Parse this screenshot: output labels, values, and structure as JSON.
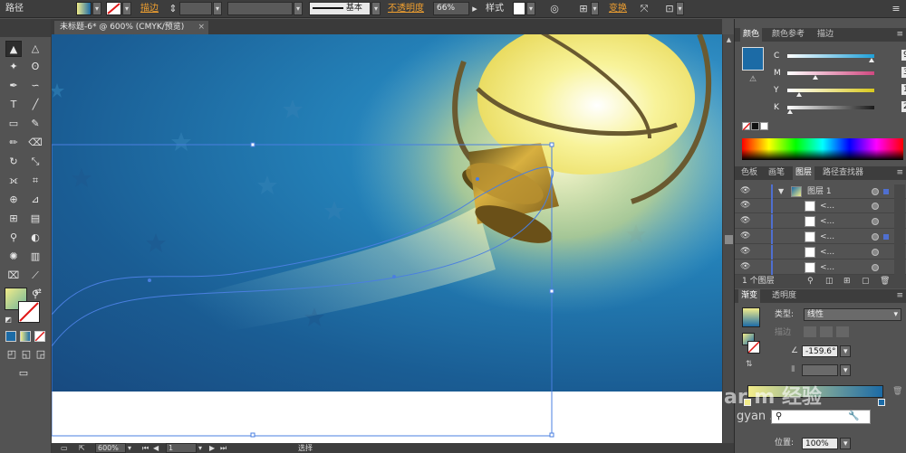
{
  "controlbar": {
    "object_label": "路径",
    "stroke_label": "描边",
    "stroke_profile": "基本",
    "opacity_label": "不透明度",
    "opacity_value": "66%",
    "style_label": "样式",
    "transform_label": "变换"
  },
  "document": {
    "tab_title": "未标题-6* @ 600% (CMYK/预览)",
    "close_glyph": "×"
  },
  "statusbar": {
    "zoom": "600%",
    "artboard_nav_value": "1",
    "tool_status": "选择"
  },
  "color_panel": {
    "tabs": [
      "颜色",
      "颜色参考",
      "描边"
    ],
    "channels": [
      {
        "name": "C",
        "value": "97.3",
        "level": 0.973,
        "color": "#1ea0d8"
      },
      {
        "name": "M",
        "value": "31.99",
        "level": 0.32,
        "color": "#d04880"
      },
      {
        "name": "Y",
        "value": "13.91",
        "level": 0.139,
        "color": "#d8c81e"
      },
      {
        "name": "K",
        "value": "2.87",
        "level": 0.029,
        "color": "#1a1a1a"
      }
    ],
    "fill_color": "#1c6ba6",
    "unit": "%"
  },
  "layers_panel": {
    "tabs": [
      "色板",
      "画笔",
      "图层",
      "路径查找器"
    ],
    "top_layer": "图层 1",
    "sublayers": [
      "<...",
      "<...",
      "<...",
      "<...",
      "<..."
    ],
    "footer_count": "1 个图层"
  },
  "gradient_panel": {
    "tabs": [
      "渐变",
      "透明度"
    ],
    "type_label": "类型:",
    "type_value": "线性",
    "stroke_label": "描边",
    "angle_label": "∠",
    "angle_value": "-159.6°",
    "location_label": "位置:",
    "location_value": "100%",
    "ramp_start_color": "#f2ec8a",
    "ramp_end_color": "#1c6ba6"
  },
  "watermark": {
    "line1": "ar  m 经验",
    "line2": "gyan  .com"
  },
  "artwork_colors": {
    "lamp_glass": "#f4ef7c",
    "lamp_brass": "#c49a2c",
    "lamp_frame": "#6a5a30"
  }
}
